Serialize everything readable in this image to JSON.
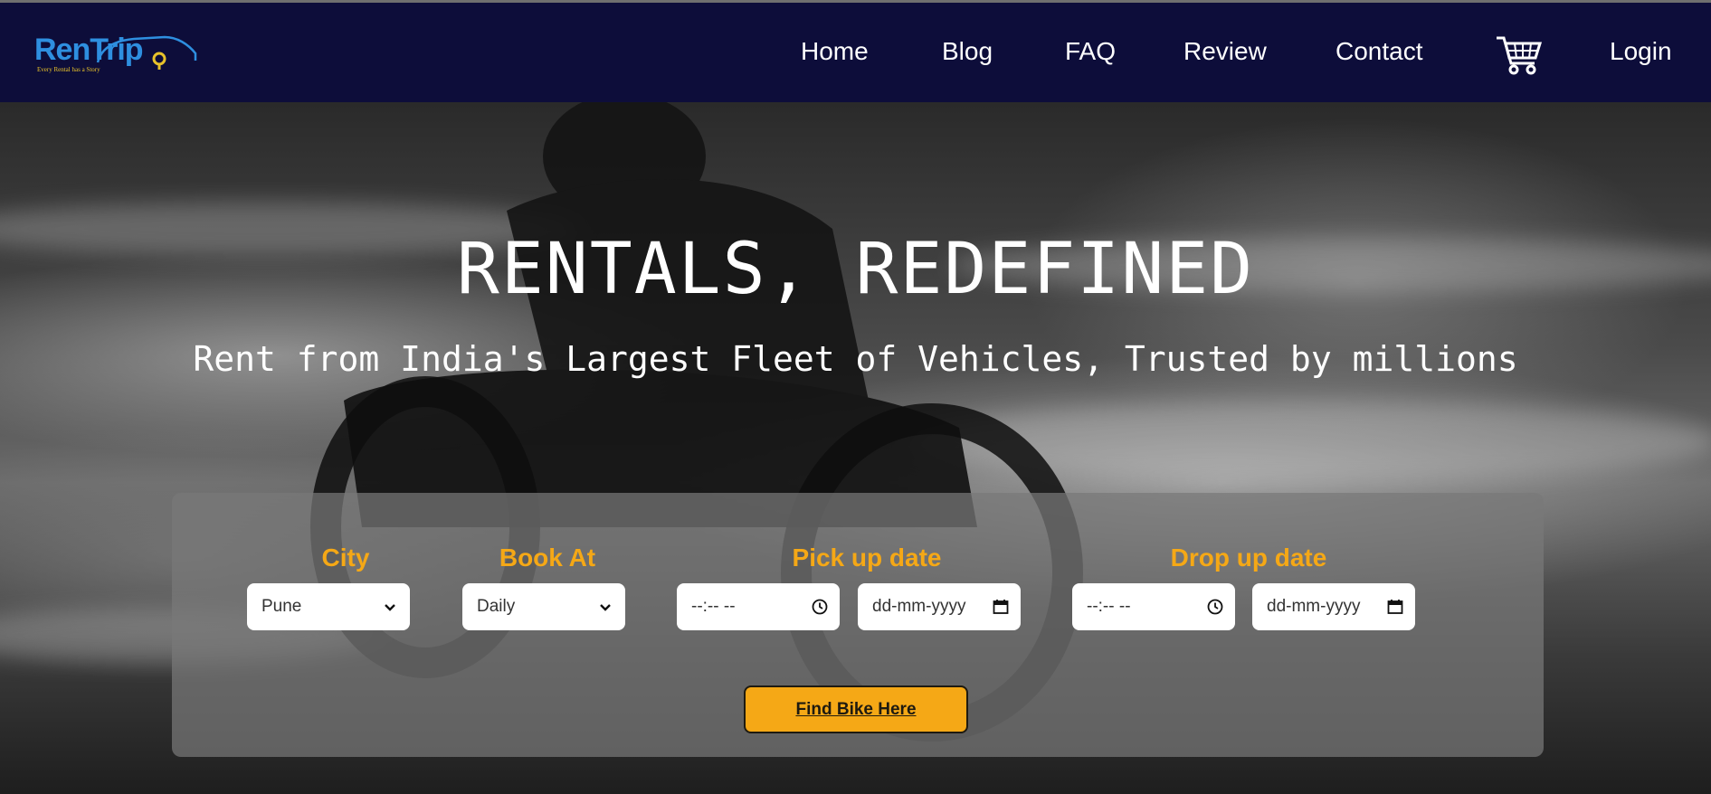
{
  "brand": {
    "name_part1": "Ren",
    "name_part2": "Trip",
    "tagline": "Every Rental has a Story",
    "colors": {
      "navbar": "#0d0d3a",
      "logo_blue": "#2e8fe0",
      "logo_yellow": "#e8c22a"
    }
  },
  "nav": {
    "items": [
      {
        "label": "Home"
      },
      {
        "label": "Blog"
      },
      {
        "label": "FAQ"
      },
      {
        "label": "Review"
      },
      {
        "label": "Contact"
      }
    ],
    "cart_icon": "shopping-cart-icon",
    "login_label": "Login"
  },
  "hero": {
    "title": "RENTALS, REDEFINED",
    "subtitle": "Rent from India's Largest Fleet of Vehicles, Trusted by millions"
  },
  "booking": {
    "accent_color": "#f5a816",
    "city": {
      "label": "City",
      "value": "Pune"
    },
    "book_at": {
      "label": "Book At",
      "value": "Daily"
    },
    "pickup": {
      "label": "Pick up date",
      "time_placeholder": "--:-- --",
      "date_placeholder": "dd-mm-yyyy"
    },
    "dropoff": {
      "label": "Drop up date",
      "time_placeholder": "--:-- --",
      "date_placeholder": "dd-mm-yyyy"
    },
    "submit_label": "Find Bike Here"
  }
}
